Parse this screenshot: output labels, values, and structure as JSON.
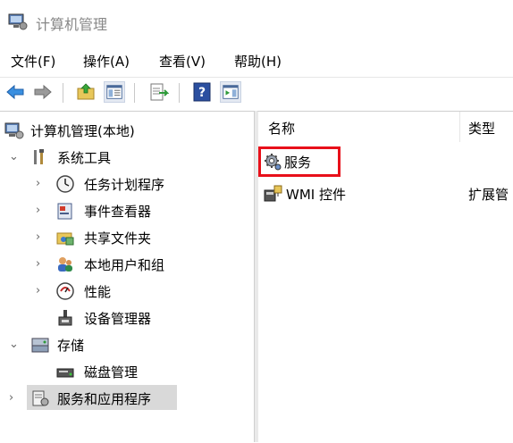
{
  "window": {
    "title": "计算机管理"
  },
  "menu": [
    "文件(F)",
    "操作(A)",
    "查看(V)",
    "帮助(H)"
  ],
  "toolbar_icons": [
    "back-arrow-icon",
    "forward-arrow-icon",
    "up-folder-icon",
    "show-hide-tree-icon",
    "export-list-icon",
    "help-icon",
    "action-pane-icon"
  ],
  "tree": {
    "root": "计算机管理(本地)",
    "system_tools": "系统工具",
    "task_scheduler": "任务计划程序",
    "event_viewer": "事件查看器",
    "shared_folders": "共享文件夹",
    "local_users": "本地用户和组",
    "performance": "性能",
    "device_manager": "设备管理器",
    "storage": "存储",
    "disk_management": "磁盘管理",
    "services_apps": "服务和应用程序"
  },
  "list": {
    "col_name": "名称",
    "col_type": "类型",
    "rows": [
      {
        "name": "服务",
        "type": ""
      },
      {
        "name": "WMI 控件",
        "type": "扩展管"
      }
    ]
  },
  "colors": {
    "highlight": "#e8101a",
    "selection": "#d9d9d9"
  }
}
